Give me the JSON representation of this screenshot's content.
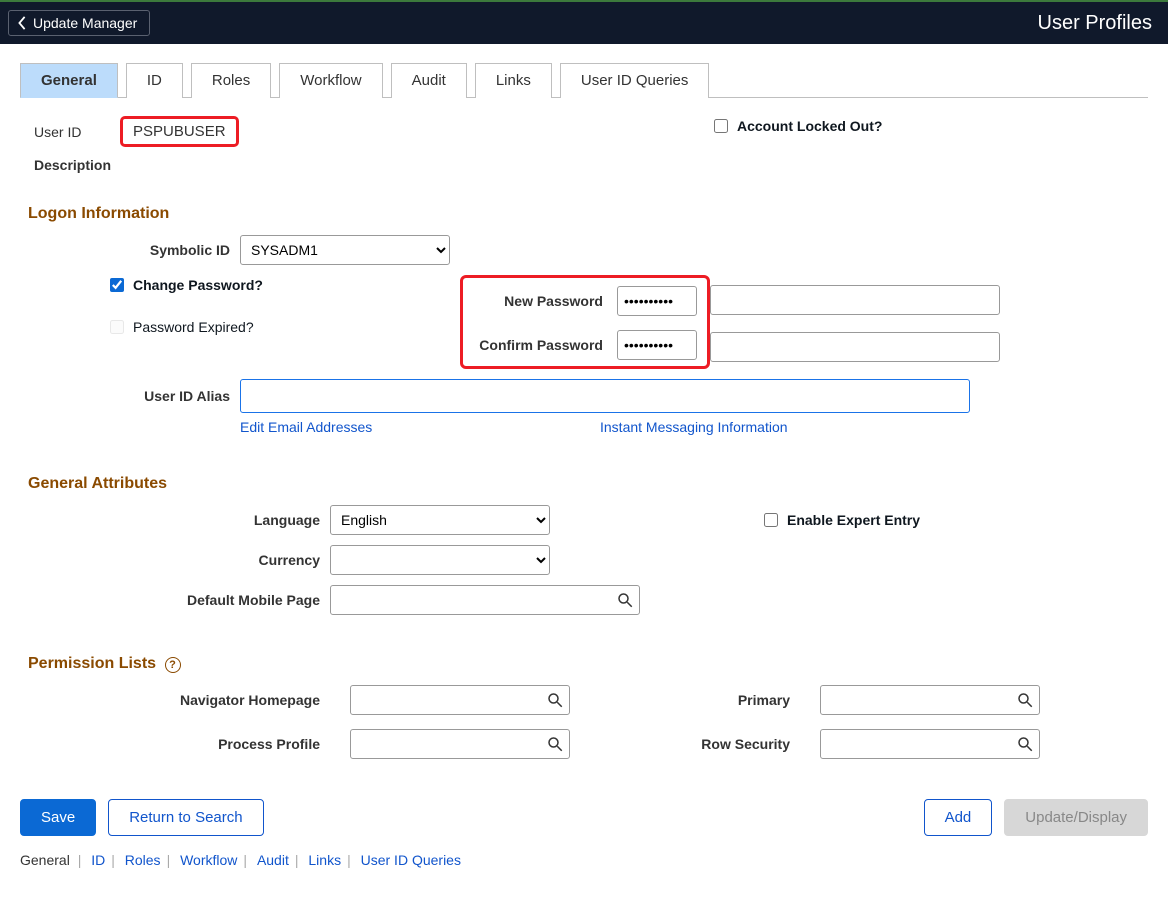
{
  "header": {
    "back_label": "Update Manager",
    "title": "User Profiles"
  },
  "tabs": [
    "General",
    "ID",
    "Roles",
    "Workflow",
    "Audit",
    "Links",
    "User ID Queries"
  ],
  "active_tab_index": 0,
  "fields": {
    "user_id_label": "User ID",
    "user_id_value": "PSPUBUSER",
    "description_label": "Description",
    "account_locked_label": "Account Locked Out?",
    "account_locked_checked": false
  },
  "logon": {
    "section_title": "Logon Information",
    "symbolic_id_label": "Symbolic ID",
    "symbolic_id_value": "SYSADM1",
    "change_password_label": "Change Password?",
    "change_password_checked": true,
    "password_expired_label": "Password Expired?",
    "password_expired_checked": false,
    "new_password_label": "New Password",
    "new_password_value": "••••••••••",
    "confirm_password_label": "Confirm Password",
    "confirm_password_value": "••••••••••",
    "user_id_alias_label": "User ID Alias",
    "user_id_alias_value": "",
    "edit_email_link": "Edit Email Addresses",
    "im_info_link": "Instant Messaging Information"
  },
  "general_attributes": {
    "section_title": "General Attributes",
    "language_label": "Language",
    "language_value": "English",
    "currency_label": "Currency",
    "currency_value": "",
    "default_mobile_label": "Default Mobile Page",
    "default_mobile_value": "",
    "enable_expert_label": "Enable Expert Entry",
    "enable_expert_checked": false
  },
  "permission_lists": {
    "section_title": "Permission Lists",
    "help_tip": "?",
    "navigator_label": "Navigator Homepage",
    "navigator_value": "",
    "process_profile_label": "Process Profile",
    "process_profile_value": "",
    "primary_label": "Primary",
    "primary_value": "",
    "row_security_label": "Row Security",
    "row_security_value": ""
  },
  "buttons": {
    "save": "Save",
    "return_to_search": "Return to Search",
    "add": "Add",
    "update_display": "Update/Display"
  },
  "footer_links": [
    "General",
    "ID",
    "Roles",
    "Workflow",
    "Audit",
    "Links",
    "User ID Queries"
  ]
}
